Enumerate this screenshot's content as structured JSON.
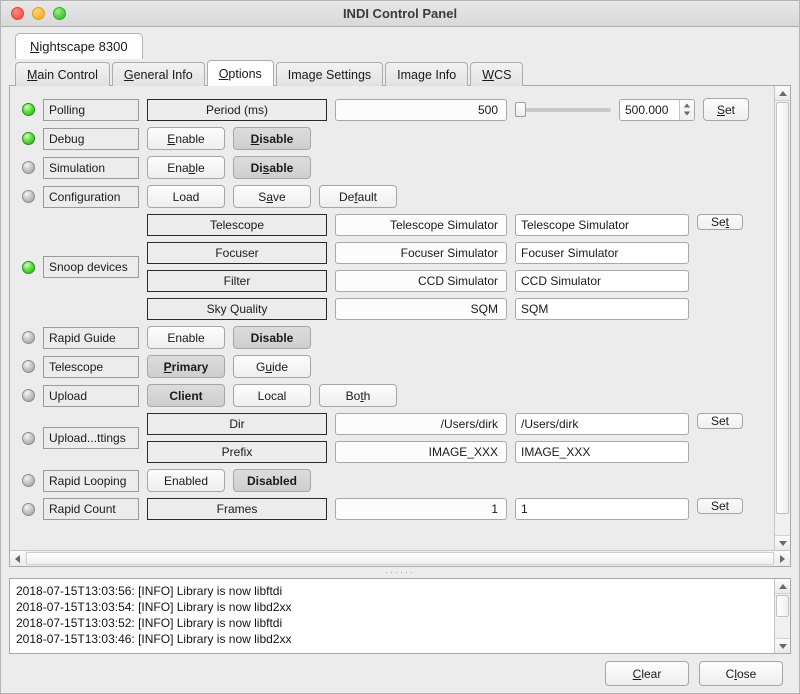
{
  "window": {
    "title": "INDI Control Panel",
    "traffic_lights": [
      "close-red",
      "minimize-yellow",
      "zoom-green"
    ]
  },
  "device_tabs": [
    {
      "label": "Nightscape 8300",
      "mnemonic_index": 0,
      "active": true
    }
  ],
  "tabs": [
    {
      "label": "Main Control",
      "mnemonic_index": 0,
      "active": false
    },
    {
      "label": "General Info",
      "mnemonic_index": 0,
      "active": false
    },
    {
      "label": "Options",
      "mnemonic_index": 0,
      "active": true
    },
    {
      "label": "Image Settings",
      "mnemonic_index": -1,
      "active": false
    },
    {
      "label": "Image Info",
      "mnemonic_index": -1,
      "active": false
    },
    {
      "label": "WCS",
      "mnemonic_index": 0,
      "active": false
    }
  ],
  "properties": [
    {
      "name": "polling",
      "label": "Polling",
      "led": "on",
      "type": "number",
      "element_label": "Period (ms)",
      "read_value": "500",
      "slider_percent": 0,
      "spin_value": "500.000",
      "set_label": "Set",
      "set_mnemonic_index": 0
    },
    {
      "name": "debug",
      "label": "Debug",
      "led": "on",
      "type": "switch",
      "buttons": [
        {
          "label": "Enable",
          "selected": false,
          "mnemonic_index": 0
        },
        {
          "label": "Disable",
          "selected": true,
          "mnemonic_index": 0
        }
      ]
    },
    {
      "name": "simulation",
      "label": "Simulation",
      "led": "off",
      "type": "switch",
      "buttons": [
        {
          "label": "Enable",
          "selected": false,
          "mnemonic_index": 3
        },
        {
          "label": "Disable",
          "selected": true,
          "mnemonic_index": 2
        }
      ]
    },
    {
      "name": "configuration",
      "label": "Configuration",
      "led": "off",
      "type": "switch",
      "buttons": [
        {
          "label": "Load",
          "selected": false,
          "mnemonic_index": -1
        },
        {
          "label": "Save",
          "selected": false,
          "mnemonic_index": 1
        },
        {
          "label": "Default",
          "selected": false,
          "mnemonic_index": 2
        }
      ]
    },
    {
      "name": "snoop-devices",
      "label": "Snoop devices",
      "led": "on",
      "type": "text-group",
      "set_label": "Set",
      "set_mnemonic_index": 2,
      "rows": [
        {
          "element_label": "Telescope",
          "read_value": "Telescope Simulator",
          "input_value": "Telescope Simulator"
        },
        {
          "element_label": "Focuser",
          "read_value": "Focuser Simulator",
          "input_value": "Focuser Simulator"
        },
        {
          "element_label": "Filter",
          "read_value": "CCD Simulator",
          "input_value": "CCD Simulator"
        },
        {
          "element_label": "Sky Quality",
          "read_value": "SQM",
          "input_value": "SQM"
        }
      ]
    },
    {
      "name": "rapid-guide",
      "label": "Rapid Guide",
      "led": "off",
      "type": "switch",
      "buttons": [
        {
          "label": "Enable",
          "selected": false,
          "mnemonic_index": -1
        },
        {
          "label": "Disable",
          "selected": true,
          "mnemonic_index": -1
        }
      ]
    },
    {
      "name": "telescope",
      "label": "Telescope",
      "led": "off",
      "type": "switch",
      "buttons": [
        {
          "label": "Primary",
          "selected": true,
          "mnemonic_index": 0
        },
        {
          "label": "Guide",
          "selected": false,
          "mnemonic_index": 1
        }
      ]
    },
    {
      "name": "upload",
      "label": "Upload",
      "led": "off",
      "type": "switch",
      "buttons": [
        {
          "label": "Client",
          "selected": true,
          "mnemonic_index": -1
        },
        {
          "label": "Local",
          "selected": false,
          "mnemonic_index": -1
        },
        {
          "label": "Both",
          "selected": false,
          "mnemonic_index": 2
        }
      ]
    },
    {
      "name": "upload-settings",
      "label": "Upload...ttings",
      "led": "off",
      "type": "text-group",
      "set_label": "Set",
      "set_mnemonic_index": -1,
      "rows": [
        {
          "element_label": "Dir",
          "read_value": "/Users/dirk",
          "input_value": "/Users/dirk"
        },
        {
          "element_label": "Prefix",
          "read_value": "IMAGE_XXX",
          "input_value": "IMAGE_XXX"
        }
      ]
    },
    {
      "name": "rapid-looping",
      "label": "Rapid Looping",
      "led": "off",
      "type": "switch",
      "buttons": [
        {
          "label": "Enabled",
          "selected": false,
          "mnemonic_index": -1
        },
        {
          "label": "Disabled",
          "selected": true,
          "mnemonic_index": -1
        }
      ]
    },
    {
      "name": "rapid-count",
      "label": "Rapid Count",
      "led": "off",
      "type": "text-group",
      "set_label": "Set",
      "set_mnemonic_index": -1,
      "rows": [
        {
          "element_label": "Frames",
          "read_value": "1",
          "input_value": "1"
        }
      ]
    }
  ],
  "log": {
    "lines": [
      "2018-07-15T13:03:56: [INFO] Library is now libftdi",
      "2018-07-15T13:03:54: [INFO] Library is now libd2xx",
      "2018-07-15T13:03:52: [INFO] Library is now libftdi",
      "2018-07-15T13:03:46: [INFO] Library is now libd2xx"
    ]
  },
  "footer": {
    "clear_label": "Clear",
    "clear_mnemonic_index": 0,
    "close_label": "Close",
    "close_mnemonic_index": 1
  },
  "colors": {
    "led_on": "#41c63c",
    "led_off": "#c0c0c0",
    "window_bg": "#ececec",
    "panel_bg": "#ececec"
  }
}
